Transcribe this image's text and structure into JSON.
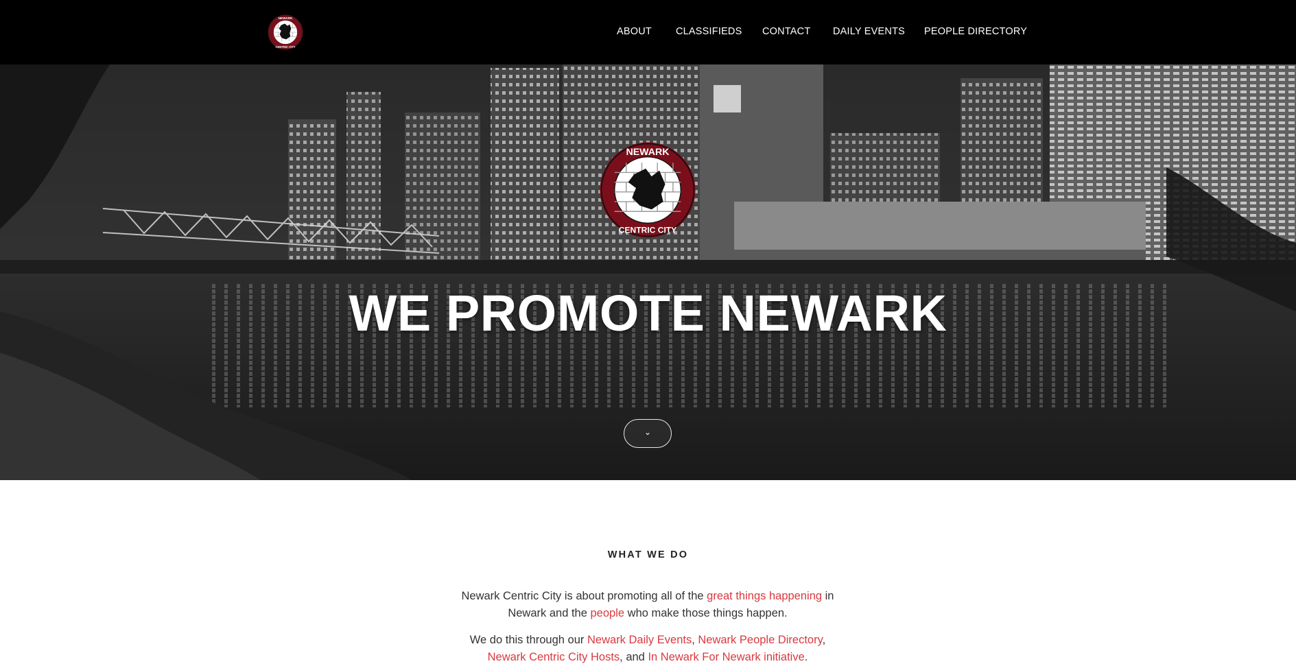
{
  "nav": {
    "items": [
      {
        "label": "ABOUT"
      },
      {
        "label": "CLASSIFIEDS"
      },
      {
        "label": "CONTACT"
      },
      {
        "label": "DAILY EVENTS"
      },
      {
        "label": "PEOPLE DIRECTORY"
      }
    ]
  },
  "logo": {
    "top_text": "NEWARK",
    "bottom_text": "CENTRIC CITY",
    "colors": {
      "ring": "#7a0f1b",
      "brick": "#ffffff",
      "silhouette": "#111111"
    }
  },
  "hero": {
    "title": "WE PROMOTE NEWARK",
    "scroll_icon": "chevron-down-icon"
  },
  "what_we_do": {
    "heading": "WHAT WE DO",
    "p1": {
      "t1": "Newark Centric City is about promoting all of the ",
      "link1": "great things happening",
      "t2": " in Newark and the ",
      "link2": "people",
      "t3": " who make those things happen."
    },
    "p2": {
      "t1": "We do this through our ",
      "link1": "Newark Daily Events",
      "t2": ", ",
      "link2": "Newark People Directory",
      "t3": ", ",
      "link3": "Newark Centric City Hosts",
      "t4": ", and ",
      "link4": "In Newark For Newark initiative",
      "t5": "."
    }
  },
  "colors": {
    "nav_bg": "#000000",
    "link": "#d9393f",
    "text": "#333333"
  }
}
